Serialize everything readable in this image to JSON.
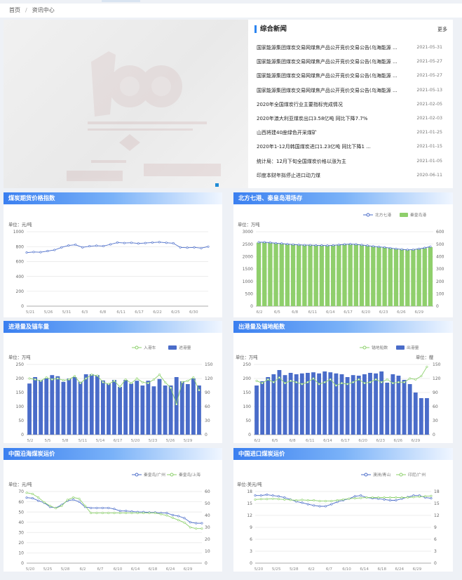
{
  "breadcrumb": {
    "home": "首页",
    "separator": "/",
    "current": "资讯中心"
  },
  "news": {
    "title": "综合新闻",
    "more": "更多",
    "items": [
      {
        "title": "国家能源集团煤炭交易网煤焦产品公开竞价交易公告(乌海能源 ...",
        "date": "2021-05-31"
      },
      {
        "title": "国家能源集团煤炭交易网煤焦产品公开竞价交易公告(乌海能源 ...",
        "date": "2021-05-27"
      },
      {
        "title": "国家能源集团煤炭交易网煤焦产品公开竞价交易公告(乌海能源 ...",
        "date": "2021-05-27"
      },
      {
        "title": "国家能源集团煤炭交易网煤焦产品公开竞价交易公告(乌海能源 ...",
        "date": "2021-05-13"
      },
      {
        "title": "2020年全国煤炭行业主要指标完成情况",
        "date": "2021-02-05"
      },
      {
        "title": "2020年澳大利亚煤炭出口3.58亿吨 同比下降7.7%",
        "date": "2021-02-03"
      },
      {
        "title": "山西将建40座绿色开采煤矿",
        "date": "2021-01-25"
      },
      {
        "title": "2020年1-12月韩国煤炭进口1.23亿吨 同比下降1 ...",
        "date": "2021-01-15"
      },
      {
        "title": "统计局：12月下旬全国煤炭价格以涨为主",
        "date": "2021-01-05"
      },
      {
        "title": "印度本财年拟停止进口动力煤",
        "date": "2020-06-11"
      }
    ]
  },
  "panels": {
    "p1": "煤炭期货价格指数",
    "p2": "北方七港、秦皇岛港场存",
    "p3": "进港量及锚车量",
    "p4": "出港量及锚地船数",
    "p5": "中国沿海煤炭运价",
    "p6": "中国进口煤炭运价"
  },
  "colors": {
    "blue": "#4a6cc9",
    "bar": "#8fcf6c",
    "green": "#8cd06b",
    "header": "#3a7ff0"
  },
  "chart_data": [
    {
      "id": "p1",
      "type": "line",
      "ylabel": "单位：元/吨",
      "x_ticks": [
        "5/21",
        "5/26",
        "5/31",
        "6/3",
        "6/8",
        "6/11",
        "6/17",
        "6/22",
        "6/25",
        "6/30"
      ],
      "ylim": [
        0,
        1000
      ],
      "y_ticks": [
        "0",
        "200",
        "400",
        "600",
        "800",
        "1000"
      ],
      "series": [
        {
          "values": [
            720,
            728,
            725,
            740,
            755,
            790,
            815,
            825,
            790,
            805,
            812,
            808,
            830,
            855,
            848,
            852,
            842,
            848,
            855,
            860,
            852,
            845,
            790,
            785,
            790,
            780,
            800
          ]
        }
      ]
    },
    {
      "id": "p2",
      "type": "bar",
      "ylabel": "单位：万吨",
      "legend": [
        "北方七港",
        "秦皇岛港"
      ],
      "x_ticks": [
        "6/2",
        "6/5",
        "6/8",
        "6/11",
        "6/14",
        "6/17",
        "6/20",
        "6/23",
        "6/26",
        "6/29"
      ],
      "ylim": [
        0,
        3000
      ],
      "y_ticks": [
        "0",
        "500",
        "1000",
        "1500",
        "2000",
        "2500",
        "3000"
      ],
      "y2lim": [
        0,
        600
      ],
      "y2_ticks": [
        "0",
        "100",
        "200",
        "300",
        "400",
        "500",
        "600"
      ],
      "bars": [
        2560,
        2560,
        2560,
        2540,
        2530,
        2510,
        2500,
        2480,
        2470,
        2470,
        2460,
        2460,
        2450,
        2460,
        2480,
        2500,
        2510,
        2500,
        2470,
        2440,
        2410,
        2390,
        2370,
        2340,
        2310,
        2300,
        2280,
        2290,
        2320,
        2340,
        2380
      ],
      "line": [
        515,
        515,
        512,
        507,
        505,
        500,
        497,
        494,
        492,
        492,
        490,
        490,
        488,
        490,
        494,
        498,
        500,
        498,
        493,
        488,
        482,
        478,
        474,
        468,
        462,
        458,
        454,
        456,
        462,
        470,
        480
      ]
    },
    {
      "id": "p3",
      "type": "bar",
      "ylabel": "单位：万吨",
      "legend": [
        "入港车",
        "进港量"
      ],
      "x_ticks": [
        "5/2",
        "5/5",
        "5/8",
        "5/11",
        "5/14",
        "6/17",
        "5/20",
        "5/23",
        "5/26",
        "5/29"
      ],
      "ylim": [
        0,
        250
      ],
      "y_ticks": [
        "0",
        "50",
        "100",
        "150",
        "200",
        "250"
      ],
      "y2lim": [
        0,
        150
      ],
      "y2_ticks": [
        "0",
        "30",
        "60",
        "90",
        "120",
        "150"
      ],
      "bars": [
        182,
        205,
        195,
        200,
        212,
        208,
        188,
        200,
        205,
        188,
        215,
        215,
        212,
        193,
        182,
        195,
        170,
        195,
        182,
        192,
        175,
        192,
        172,
        198,
        175,
        175,
        205,
        190,
        180,
        200,
        175
      ],
      "line": [
        120,
        118,
        115,
        122,
        118,
        120,
        116,
        118,
        125,
        110,
        120,
        128,
        126,
        112,
        108,
        115,
        102,
        118,
        110,
        120,
        112,
        110,
        118,
        128,
        112,
        100,
        65,
        112,
        115,
        122,
        95
      ]
    },
    {
      "id": "p4",
      "type": "bar",
      "ylabel": "单位：万吨",
      "ylabel2": "单位：艘",
      "legend": [
        "锚地船数",
        "出港量"
      ],
      "x_ticks": [
        "6/2",
        "6/5",
        "6/8",
        "6/11",
        "6/14",
        "6/17",
        "6/20",
        "6/23",
        "6/26",
        "6/29"
      ],
      "ylim": [
        0,
        250
      ],
      "y_ticks": [
        "0",
        "50",
        "100",
        "150",
        "200",
        "250"
      ],
      "y2lim": [
        0,
        150
      ],
      "y2_ticks": [
        "0",
        "30",
        "60",
        "90",
        "120",
        "150"
      ],
      "bars": [
        175,
        190,
        205,
        215,
        230,
        212,
        220,
        215,
        218,
        220,
        222,
        218,
        225,
        222,
        218,
        215,
        205,
        212,
        210,
        215,
        220,
        218,
        225,
        185,
        215,
        210,
        195,
        180,
        150,
        130,
        130
      ],
      "line": [
        115,
        110,
        118,
        112,
        122,
        110,
        115,
        112,
        108,
        112,
        120,
        108,
        112,
        118,
        105,
        110,
        108,
        112,
        118,
        110,
        112,
        118,
        112,
        118,
        110,
        112,
        112,
        120,
        118,
        125,
        145
      ]
    },
    {
      "id": "p5",
      "type": "line",
      "ylabel": "单位：元/吨",
      "legend": [
        "秦皇岛/广州",
        "秦皇岛/上海"
      ],
      "x_ticks": [
        "5/20",
        "5/25",
        "5/28",
        "6/2",
        "6/7",
        "6/10",
        "6/14",
        "6/18",
        "6/24",
        "6/29"
      ],
      "ylim": [
        0,
        70
      ],
      "y_ticks": [
        "0",
        "10",
        "20",
        "30",
        "40",
        "50",
        "60",
        "70"
      ],
      "y2lim": [
        0,
        60
      ],
      "y2_ticks": [
        "0",
        "10",
        "20",
        "30",
        "40",
        "50",
        "60"
      ],
      "series": [
        {
          "name": "秦皇岛/广州",
          "values": [
            64,
            63.5,
            61,
            59,
            55,
            54,
            57,
            61,
            62,
            60,
            55,
            54,
            54,
            54,
            54,
            53,
            51,
            51,
            50.5,
            50,
            50,
            49.5,
            49.5,
            49,
            49,
            47,
            46,
            44,
            40,
            39,
            39
          ]
        },
        {
          "name": "秦皇岛/上海",
          "values": [
            59,
            58,
            55,
            51,
            48,
            46,
            48,
            53,
            55,
            54,
            48,
            42,
            42,
            42,
            42,
            42,
            42,
            42,
            42,
            42,
            42,
            42,
            42,
            41,
            40,
            38,
            36,
            34,
            30,
            29,
            29
          ]
        }
      ]
    },
    {
      "id": "p6",
      "type": "line",
      "ylabel": "单位:美元/吨",
      "legend": [
        "澳洲/青山",
        "印尼/广州"
      ],
      "x_ticks": [
        "5/20",
        "5/25",
        "5/28",
        "6/2",
        "6/7",
        "6/10",
        "6/14",
        "6/18",
        "6/24",
        "6/29"
      ],
      "ylim": [
        0,
        18
      ],
      "y_ticks": [
        "0",
        "3",
        "6",
        "9",
        "12",
        "15",
        "18"
      ],
      "y2lim": [
        0,
        18
      ],
      "y2_ticks": [
        "0",
        "3",
        "6",
        "9",
        "12",
        "15",
        "18"
      ],
      "series": [
        {
          "name": "澳洲/青山",
          "values": [
            17,
            17,
            17.2,
            17,
            16.8,
            16.5,
            16,
            15.5,
            15.2,
            14.8,
            14.5,
            14.3,
            14.3,
            14.8,
            15.4,
            15.8,
            16.2,
            16.8,
            17,
            16.5,
            16.3,
            16.2,
            16,
            15.8,
            15.8,
            16.2,
            16.6,
            17,
            17,
            16.5,
            16.3
          ]
        },
        {
          "name": "印尼/广州",
          "values": [
            16,
            16.1,
            16.1,
            16.2,
            16.1,
            16,
            15.9,
            15.8,
            15.9,
            15.8,
            15.8,
            15.6,
            15.6,
            15.6,
            15.8,
            16,
            16.2,
            16.3,
            16.4,
            16.5,
            16.5,
            16.5,
            16.5,
            16.5,
            16.5,
            16.5,
            16.5,
            16.6,
            16.7,
            16.8,
            16.9
          ]
        }
      ]
    }
  ]
}
